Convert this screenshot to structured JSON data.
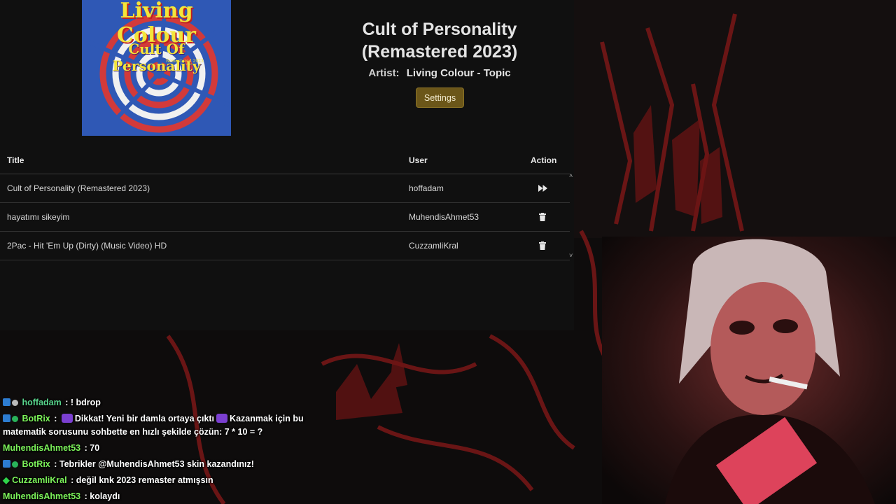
{
  "theme": {
    "accent": "#6b5619",
    "bot_name_color": "#7cf35a",
    "user_name_color": "#7cf35a",
    "hoffadam_color": "#58d68d"
  },
  "album": {
    "band": "Living Colour",
    "title": "Cult Of Personality",
    "subtitle": "Remastered 2023"
  },
  "now_playing": {
    "title_line1": "Cult of Personality",
    "title_line2": "(Remastered 2023)",
    "artist_label": "Artist:",
    "artist": "Living Colour - Topic",
    "settings_label": "Settings"
  },
  "queue": {
    "columns": [
      "Title",
      "User",
      "Action"
    ],
    "rows": [
      {
        "title": "Cult of Personality (Remastered 2023)",
        "user": "hoffadam",
        "action_icon": "fast-forward-icon"
      },
      {
        "title": "hayatımı sikeyim",
        "user": "MuhendisAhmet53",
        "action_icon": "trash-icon"
      },
      {
        "title": "2Pac - Hit 'Em Up (Dirty) (Music Video) HD",
        "user": "CuzzamliKral",
        "action_icon": "trash-icon"
      }
    ],
    "scroll_up": "˄",
    "scroll_down": "˅"
  },
  "chat": [
    {
      "user": "hoffadam",
      "sep": " : ",
      "text": "! bdrop"
    },
    {
      "user": "BotRix",
      "sep": " : ",
      "text_a": "Dikkat! Yeni bir damla ortaya çıktı",
      "text_b": "Kazanmak için bu matematik sorusunu sohbette en hızlı şekilde çözün: 7 * 10 = ?"
    },
    {
      "user": "MuhendisAhmet53",
      "sep": " : ",
      "text": "70"
    },
    {
      "user": "BotRix",
      "sep": " : ",
      "text": "Tebrikler @MuhendisAhmet53 skin kazandınız!"
    },
    {
      "user": "CuzzamliKral",
      "sep": " : ",
      "text": "değil knk 2023 remaster atmışsın"
    },
    {
      "user": "MuhendisAhmet53",
      "sep": " : ",
      "text": "kolaydı"
    }
  ]
}
